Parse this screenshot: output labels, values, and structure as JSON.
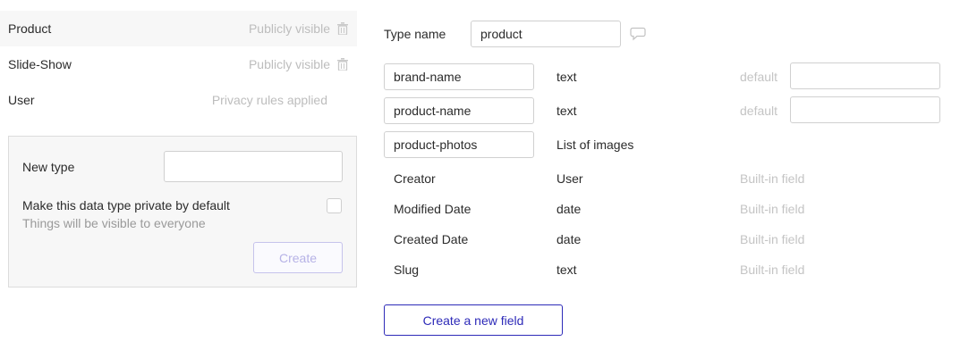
{
  "data_types": [
    {
      "name": "Product",
      "privacy": "Publicly visible",
      "deletable": true,
      "selected": true
    },
    {
      "name": "Slide-Show",
      "privacy": "Publicly visible",
      "deletable": true,
      "selected": false
    },
    {
      "name": "User",
      "privacy": "Privacy rules applied",
      "deletable": false,
      "selected": false
    }
  ],
  "new_type_panel": {
    "label": "New type",
    "input_value": "",
    "private_label": "Make this data type private by default",
    "private_sublabel": "Things will be visible to everyone",
    "private_checked": false,
    "create_label": "Create"
  },
  "editor": {
    "type_name_label": "Type name",
    "type_name_value": "product",
    "comment_icon": "comment-icon",
    "custom_fields": [
      {
        "name": "brand-name",
        "type": "text",
        "default_label": "default",
        "default_value": ""
      },
      {
        "name": "product-name",
        "type": "text",
        "default_label": "default",
        "default_value": ""
      },
      {
        "name": "product-photos",
        "type": "List of images"
      }
    ],
    "builtin_fields": [
      {
        "name": "Creator",
        "type": "User",
        "note": "Built-in field"
      },
      {
        "name": "Modified Date",
        "type": "date",
        "note": "Built-in field"
      },
      {
        "name": "Created Date",
        "type": "date",
        "note": "Built-in field"
      },
      {
        "name": "Slug",
        "type": "text",
        "note": "Built-in field"
      }
    ],
    "new_field_label": "Create a new field"
  },
  "colors": {
    "accent": "#2d2ab8",
    "accent_disabled": "#b6b2e6",
    "muted_text": "#c4c4c4",
    "panel_bg": "#f7f7f7"
  }
}
